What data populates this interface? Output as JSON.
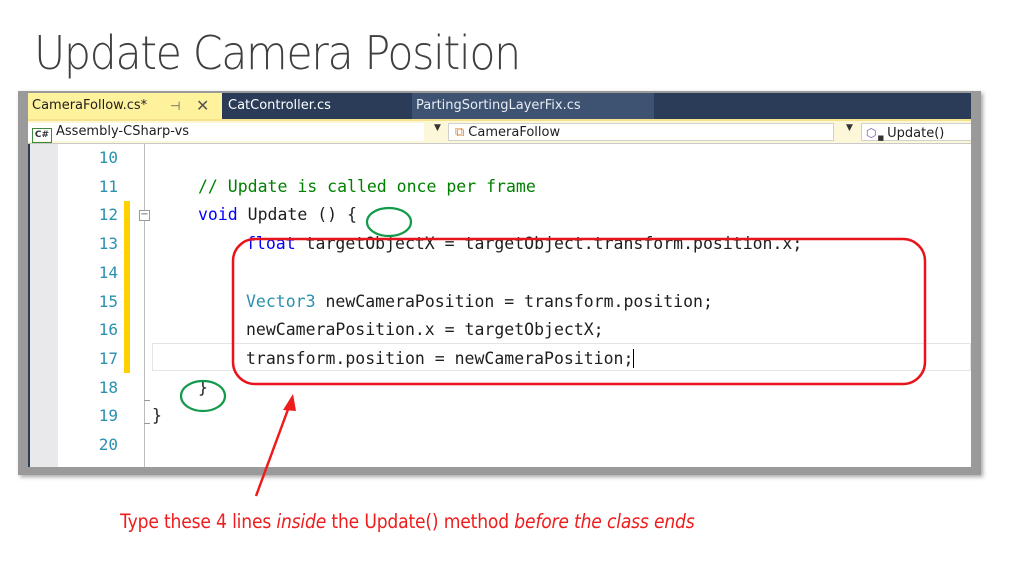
{
  "slide": {
    "title": "Update Camera Position",
    "caption": {
      "part1": "Type these 4 lines ",
      "italic1": "inside",
      "part2": " the Update() method ",
      "italic2": "before the class ends"
    }
  },
  "ide": {
    "tabs": [
      {
        "label": "CameraFollow.cs*",
        "active": true,
        "pin_icon": "pin-icon",
        "close_icon": "close-icon"
      },
      {
        "label": "CatController.cs",
        "active": false
      },
      {
        "label": "PartingSortingLayerFix.cs",
        "active": false
      }
    ],
    "nav_bar": {
      "project": {
        "icon": "csharp-project-icon",
        "icon_text": "C#",
        "label": "Assembly-CSharp-vs"
      },
      "class": {
        "icon": "class-icon",
        "label": "CameraFollow"
      },
      "member": {
        "icon": "method-icon",
        "label": "Update()"
      }
    },
    "editor": {
      "lines": [
        {
          "number": "10",
          "text": ""
        },
        {
          "number": "11",
          "comment": "// Update is called once per frame"
        },
        {
          "number": "12",
          "keyword": "void",
          "text": " Update () {"
        },
        {
          "number": "13",
          "keyword": "float",
          "text": " targetObjectX = targetObject.transform.position.x;"
        },
        {
          "number": "14",
          "text": ""
        },
        {
          "number": "15",
          "type": "Vector3",
          "text": " newCameraPosition = transform.position;"
        },
        {
          "number": "16",
          "text": "newCameraPosition.x = targetObjectX;"
        },
        {
          "number": "17",
          "text": "transform.position = newCameraPosition;"
        },
        {
          "number": "18",
          "text": "}"
        },
        {
          "number": "19",
          "text": "}"
        },
        {
          "number": "20",
          "text": ""
        }
      ],
      "changed_lines": [
        "12",
        "13",
        "14",
        "15",
        "16",
        "17"
      ],
      "current_line": "17"
    }
  },
  "annotation_colors": {
    "highlight_box": "#e8141c",
    "brace_circle": "#129a4a",
    "caption": "#ee1c1c"
  }
}
